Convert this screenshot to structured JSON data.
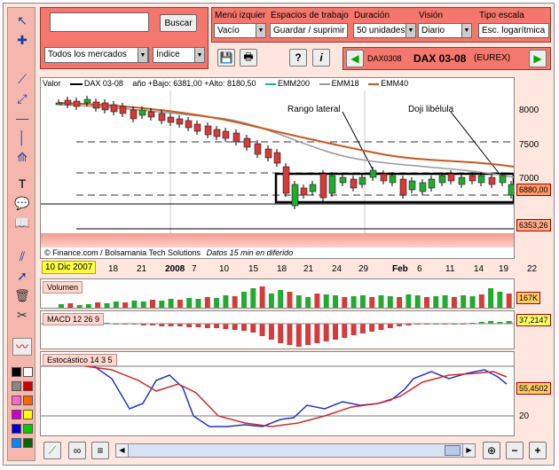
{
  "search": {
    "value": "",
    "button": "Buscar"
  },
  "filters": {
    "market": "Todos los mercados",
    "type": "Índice"
  },
  "menu": {
    "izq_label": "Menú izquier",
    "izq_value": "Vacío",
    "espacios_label": "Espacios de trabajo",
    "espacios_value": "Guardar / suprimir",
    "duracion_label": "Duración",
    "duracion_value": "50 unidades",
    "vision_label": "Visión",
    "vision_value": "Diario",
    "escala_label": "Tipo escala",
    "escala_value": "Esc. logarítmica"
  },
  "instrument": {
    "code": "DAX0308",
    "name": "DAX 03-08",
    "exchange": "(EUREX)"
  },
  "chart_data": {
    "type": "candlestick",
    "legend": {
      "valor": "Valor",
      "series": "DAX 03-08",
      "stats": "año +Bajo: 6381,00 +Alto: 8180,50",
      "emm200": "EMM200",
      "emm18": "EMM18",
      "emm40": "EMM40"
    },
    "annotations": {
      "rango": "Rango lateral",
      "doji": "Doji libélula"
    },
    "source": "© Finance.com / Bolsamania Tech Solutions",
    "delay": "Datos 15 min en diferido",
    "date_start": "10 Dic 2007",
    "x_ticks": [
      "18",
      "21",
      "2008",
      "7",
      "10",
      "15",
      "18",
      "21",
      "24",
      "29",
      "Feb",
      "6",
      "11",
      "14",
      "19",
      "22"
    ],
    "y_ticks": [
      "8000",
      "7500",
      "7000"
    ],
    "price_tags": {
      "last": "6880,00",
      "low": "6353,26"
    },
    "volume": {
      "label": "Volumen",
      "last": "167K"
    },
    "macd": {
      "label": "MACD 12 26 9",
      "last": "37,2147"
    },
    "stoch": {
      "label": "Estocástico 14 3 5",
      "last": "55,4502",
      "level": "20"
    }
  },
  "colors": {
    "up": "#22aa33",
    "down": "#d63b3b",
    "emm200": "#20b0a0",
    "emm18": "#999999",
    "emm40": "#c8581f"
  }
}
